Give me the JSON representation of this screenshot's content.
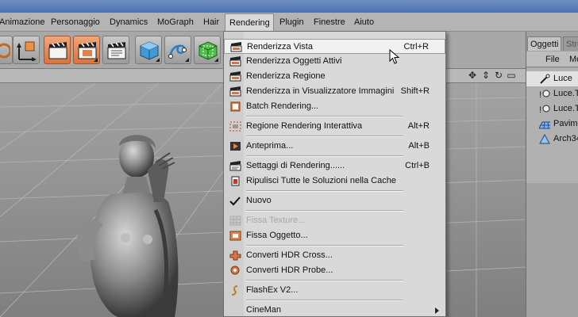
{
  "menubar": {
    "items": [
      {
        "label": "Animazione"
      },
      {
        "label": "Personaggio"
      },
      {
        "label": "Dynamics"
      },
      {
        "label": "MoGraph"
      },
      {
        "label": "Hair"
      },
      {
        "label": "Rendering",
        "active": true
      },
      {
        "label": "Plugin"
      },
      {
        "label": "Finestre"
      },
      {
        "label": "Aiuto"
      }
    ]
  },
  "toolbar": {
    "buttons": [
      "render-view-icon",
      "render-picture-viewer-icon",
      "render-settings-icon",
      "cube-icon",
      "spline-icon",
      "nurbs-icon"
    ]
  },
  "rendering_menu": {
    "items": [
      {
        "label": "Renderizza Vista",
        "shortcut": "Ctrl+R",
        "icon": "clapper-icon",
        "hover": true
      },
      {
        "label": "Renderizza Oggetti Attivi",
        "shortcut": "",
        "icon": "clapper-icon"
      },
      {
        "label": "Renderizza Regione",
        "shortcut": "",
        "icon": "clapper-icon"
      },
      {
        "label": "Renderizza in Visualizzatore Immagini",
        "shortcut": "Shift+R",
        "icon": "clapper-icon"
      },
      {
        "label": "Batch Rendering...",
        "shortcut": "",
        "icon": "batch-icon"
      },
      {
        "label": "Regione Rendering Interattiva",
        "shortcut": "Alt+R",
        "icon": "region-icon"
      },
      {
        "label": "Anteprima...",
        "shortcut": "Alt+B",
        "icon": "preview-icon"
      },
      {
        "label": "Settaggi di Rendering......",
        "shortcut": "Ctrl+B",
        "icon": "settings-icon"
      },
      {
        "label": "Ripulisci Tutte le Soluzioni nella Cache",
        "shortcut": "",
        "icon": "flush-icon"
      },
      {
        "label": "Nuovo",
        "shortcut": "",
        "icon": "checkmark-icon"
      },
      {
        "label": "Fissa Texture...",
        "shortcut": "",
        "icon": "bake-texture-icon",
        "disabled": true
      },
      {
        "label": "Fissa Oggetto...",
        "shortcut": "",
        "icon": "bake-object-icon"
      },
      {
        "label": "Converti HDR Cross...",
        "shortcut": "",
        "icon": "hdr-cross-icon"
      },
      {
        "label": "Converti HDR Probe...",
        "shortcut": "",
        "icon": "hdr-probe-icon"
      },
      {
        "label": "FlashEx V2...",
        "shortcut": "",
        "icon": "flash-icon"
      },
      {
        "label": "CineMan",
        "shortcut": "",
        "icon": "",
        "submenu": true
      }
    ]
  },
  "object_panel": {
    "tabs": [
      {
        "label": "Oggetti",
        "active": true
      },
      {
        "label": "Strut",
        "active": false
      }
    ],
    "menu": [
      "File",
      "Mo"
    ],
    "objects": [
      {
        "label": "Luce",
        "icon": "light-icon",
        "selected": true
      },
      {
        "label": "Luce.T",
        "icon": "target-light-icon"
      },
      {
        "label": "Luce.T",
        "icon": "target-light-icon"
      },
      {
        "label": "Pavime",
        "icon": "floor-icon"
      },
      {
        "label": "Arch34",
        "icon": "object-icon"
      }
    ]
  },
  "colors": {
    "menu_bg": "#d9d9d9",
    "menu_hover": "#f1f1f1",
    "toolbar_accent": "#e0844f",
    "viewport_bg": "#8e8e8e"
  }
}
